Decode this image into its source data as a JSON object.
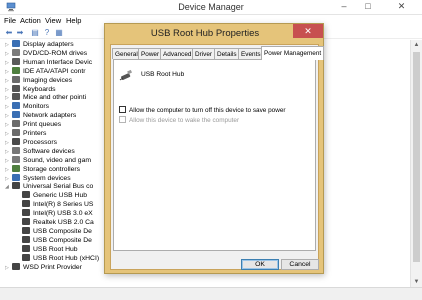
{
  "main_window": {
    "title": "Device Manager",
    "controls": {
      "minimize": "–",
      "maximize": "□",
      "close": "✕"
    },
    "menu": [
      "File",
      "Action",
      "View",
      "Help"
    ],
    "toolbar_icons": [
      "back-icon",
      "forward-icon",
      "properties-icon",
      "help-icon",
      "view-icon"
    ]
  },
  "tree": {
    "items": [
      {
        "label": "Display adapters",
        "icon": "display-adapter-icon",
        "color": "#3a6fb4"
      },
      {
        "label": "DVD/CD-ROM drives",
        "icon": "dvd-drive-icon",
        "color": "#7b7b7b"
      },
      {
        "label": "Human Interface Devic",
        "icon": "hid-icon",
        "color": "#5a5a5a"
      },
      {
        "label": "IDE ATA/ATAPI contr",
        "icon": "ide-controller-icon",
        "color": "#4f7f3f"
      },
      {
        "label": "Imaging devices",
        "icon": "camera-icon",
        "color": "#6b6b6b"
      },
      {
        "label": "Keyboards",
        "icon": "keyboard-icon",
        "color": "#555555"
      },
      {
        "label": "Mice and other pointi",
        "icon": "mouse-icon",
        "color": "#555555"
      },
      {
        "label": "Monitors",
        "icon": "monitor-icon",
        "color": "#3a6fb4"
      },
      {
        "label": "Network adapters",
        "icon": "network-adapter-icon",
        "color": "#3a6fb4"
      },
      {
        "label": "Print queues",
        "icon": "print-queue-icon",
        "color": "#6b6b6b"
      },
      {
        "label": "Printers",
        "icon": "printer-icon",
        "color": "#6b6b6b"
      },
      {
        "label": "Processors",
        "icon": "processor-icon",
        "color": "#4a4a4a"
      },
      {
        "label": "Software devices",
        "icon": "software-device-icon",
        "color": "#777777"
      },
      {
        "label": "Sound, video and gam",
        "icon": "sound-icon",
        "color": "#7a7a7a"
      },
      {
        "label": "Storage controllers",
        "icon": "storage-controller-icon",
        "color": "#4f7f3f"
      },
      {
        "label": "System devices",
        "icon": "system-device-icon",
        "color": "#3a6fb4"
      },
      {
        "label": "Universal Serial Bus co",
        "icon": "usb-icon",
        "color": "#444444"
      },
      {
        "label": "Generic USB Hub",
        "icon": "usb-plug-icon",
        "color": "#444444"
      },
      {
        "label": "Intel(R) 8 Series US",
        "icon": "usb-plug-icon",
        "color": "#444444"
      },
      {
        "label": "Intel(R) USB 3.0 eX",
        "icon": "usb-plug-icon",
        "color": "#444444"
      },
      {
        "label": "Realtek USB 2.0 Ca",
        "icon": "usb-plug-icon",
        "color": "#444444"
      },
      {
        "label": "USB Composite De",
        "icon": "usb-plug-icon",
        "color": "#444444"
      },
      {
        "label": "USB Composite De",
        "icon": "usb-plug-icon",
        "color": "#444444"
      },
      {
        "label": "USB Root Hub",
        "icon": "usb-plug-icon",
        "color": "#444444"
      },
      {
        "label": "USB Root Hub (xHCI)",
        "icon": "usb-plug-icon",
        "color": "#444444"
      },
      {
        "label": "WSD Print Provider",
        "icon": "wsd-provider-icon",
        "color": "#444444"
      }
    ]
  },
  "dialog": {
    "title": "USB Root Hub Properties",
    "close": "✕",
    "tabs": [
      "General",
      "Power",
      "Advanced",
      "Driver",
      "Details",
      "Events",
      "Power Management"
    ],
    "active_tab": "Power Management",
    "device_name": "USB Root Hub",
    "options": [
      {
        "label": "Allow the computer to turn off this device to save power",
        "checked": false,
        "enabled": true
      },
      {
        "label": "Allow this device to wake the computer",
        "checked": false,
        "enabled": false
      }
    ],
    "ok_label": "OK",
    "cancel_label": "Cancel"
  },
  "colors": {
    "dialog_frame": "#e5c47a",
    "close_button": "#c75050",
    "accent_blue": "#3a6fb4"
  }
}
